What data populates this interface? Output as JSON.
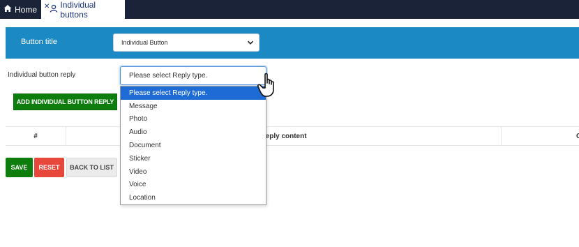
{
  "tabs": {
    "home_label": "Home",
    "active_label": "Individual buttons"
  },
  "header": {
    "button_title_label": "Button title",
    "button_title_value": "Individual Button"
  },
  "reply": {
    "label": "Individual button reply",
    "select_value": "Please select Reply type.",
    "options": [
      "Please select Reply type.",
      "Message",
      "Photo",
      "Audio",
      "Document",
      "Sticker",
      "Video",
      "Voice",
      "Location"
    ],
    "selected_index": 0
  },
  "add_button_label": "ADD INDIVIDUAL BUTTON REPLY",
  "table": {
    "columns": [
      "#",
      "Reply content",
      "Cap"
    ]
  },
  "actions": {
    "save_label": "SAVE",
    "reset_label": "RESET",
    "back_label": "BACK TO LIST"
  },
  "icons": {
    "home": "home-icon",
    "tab": "user-close-icon",
    "chevron": "chevron-down-icon",
    "cursor": "pointer-hand-icon"
  },
  "colors": {
    "topbar": "#1b2338",
    "header": "#1b8ac4",
    "green": "#0d7d0d",
    "red": "#e8473c",
    "selected_option": "#1e6bd6"
  }
}
